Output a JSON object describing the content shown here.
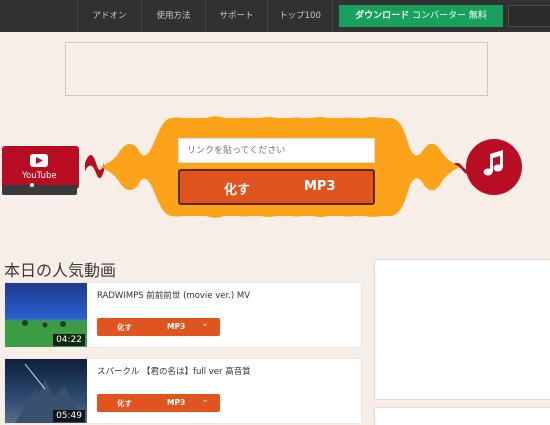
{
  "nav": {
    "items": [
      "アドオン",
      "使用方法",
      "サポート",
      "トップ100"
    ],
    "download_bold": "ダウンロード",
    "download_rest": "コンバーター 無料"
  },
  "converter": {
    "placeholder": "リンクを貼ってください",
    "btn_left": "化す",
    "btn_right": "MP3",
    "source_label": "YouTube"
  },
  "popular": {
    "title": "本日の人気動画",
    "videos": [
      {
        "title": "RADWIMPS 前前前世 (movie ver.) MV",
        "duration": "04:22",
        "btn_left": "化す",
        "btn_right": "MP3",
        "chevron": "⌄"
      },
      {
        "title": "スパークル 【君の名は】full ver 高音質",
        "duration": "05:49",
        "btn_left": "化す",
        "btn_right": "MP3",
        "chevron": "⌄"
      }
    ]
  },
  "colors": {
    "accent": "#e0541f",
    "wave": "#fca31a",
    "red": "#b80d23",
    "nav_bg": "#313131",
    "download": "#18a05d"
  },
  "icons": [
    "youtube-play-icon",
    "music-note-icon",
    "chevron-down-icon"
  ]
}
